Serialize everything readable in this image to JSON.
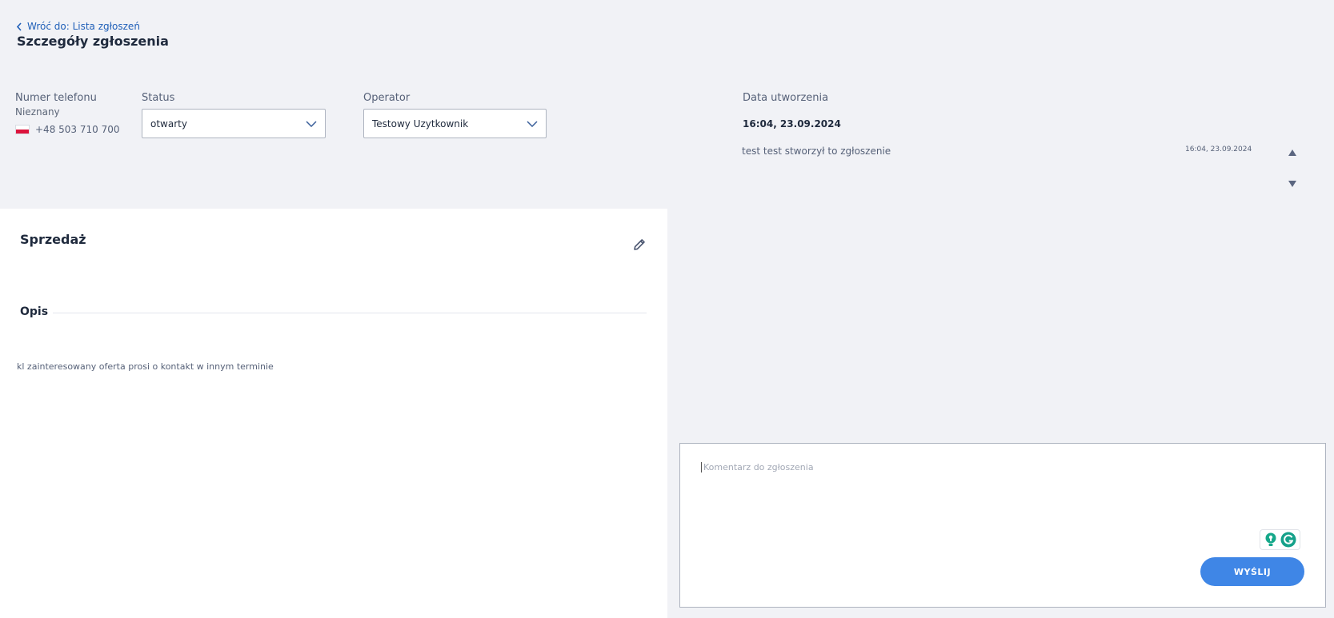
{
  "header": {
    "back_label": "Wróć do: Lista zgłoszeń",
    "title": "Szczegóły zgłoszenia"
  },
  "phone": {
    "label": "Numer telefonu",
    "name": "Nieznany",
    "number": "+48 503 710 700"
  },
  "status": {
    "label": "Status",
    "value": "otwarty"
  },
  "operator": {
    "label": "Operator",
    "value": "Testowy Uzytkownik"
  },
  "created": {
    "label": "Data utworzenia",
    "value": "16:04, 23.09.2024"
  },
  "history": [
    {
      "text": "test test stworzył to zgłoszenie",
      "time": "16:04, 23.09.2024"
    }
  ],
  "sale": {
    "title": "Sprzedaż",
    "description_title": "Opis",
    "description_text": "kl zainteresowany oferta prosi o kontakt w innym terminie"
  },
  "comment": {
    "placeholder": "Komentarz do zgłoszenia",
    "send_label": "WYŚLIJ"
  },
  "colors": {
    "background": "#f1f2f6",
    "accent": "#3f86e6",
    "link": "#1f5fb8"
  },
  "icons": [
    "chevron-left-icon",
    "chevron-down-icon",
    "flag-pl-icon",
    "triangle-up-icon",
    "triangle-down-icon",
    "pencil-icon",
    "lightbulb-icon",
    "grammarly-icon"
  ]
}
